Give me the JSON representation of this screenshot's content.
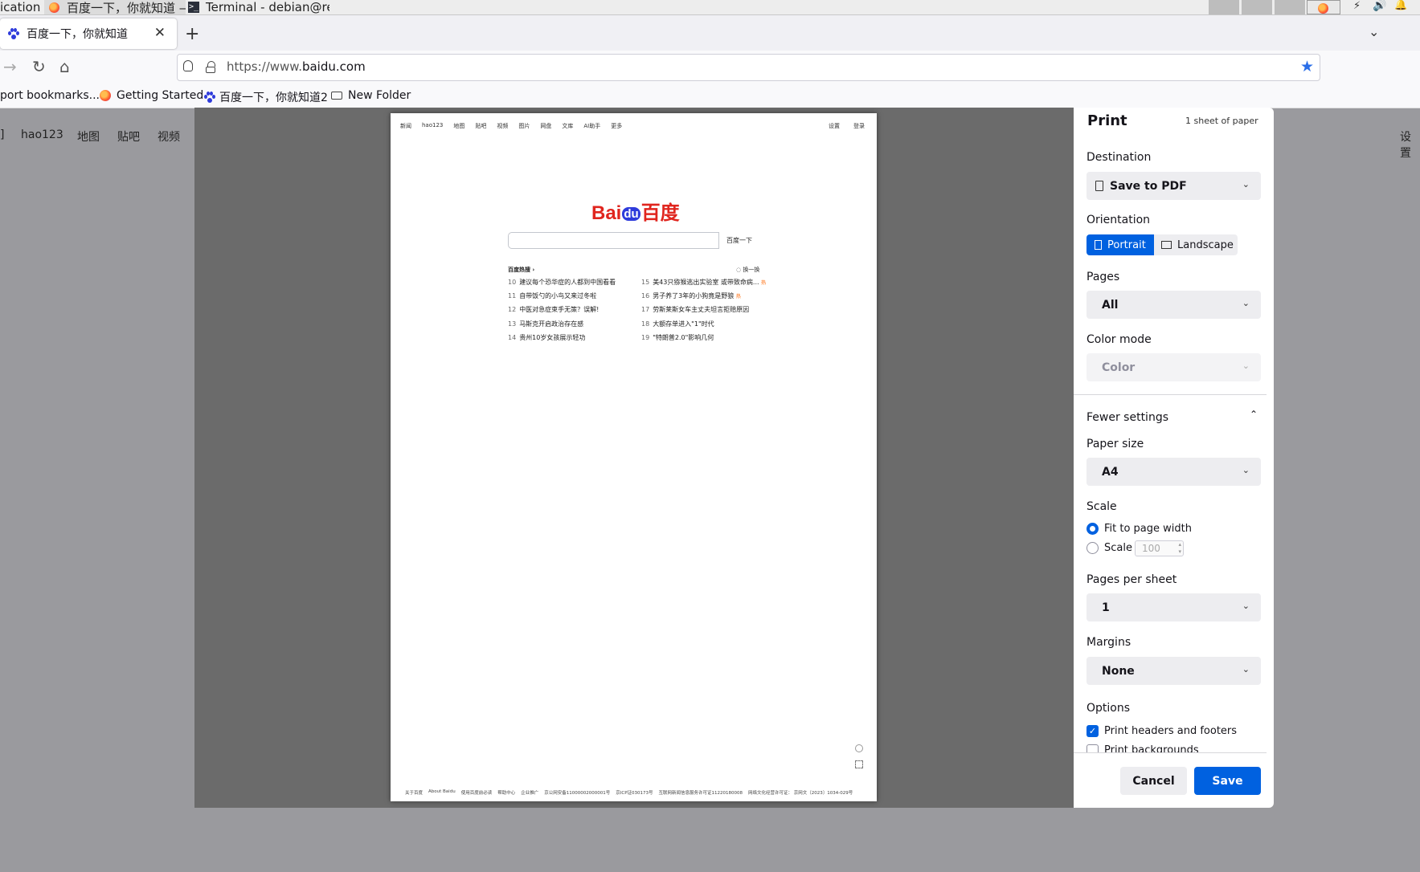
{
  "taskbar": {
    "apps_label": "ications",
    "firefox_window": "百度一下，你就知道 — Mo...",
    "terminal_window": "Terminal - debian@revyos..."
  },
  "browser": {
    "tab_title": "百度一下，你就知道",
    "new_tab": "+",
    "url_prefix": "https://www.",
    "url_domain": "baidu.com",
    "bookmarks": [
      "port bookmarks...",
      "Getting Started",
      "百度一下，你就知道2",
      "New Folder"
    ]
  },
  "page_behind": {
    "nav_left": [
      "]",
      "hao123",
      "地图",
      "贴吧",
      "视频"
    ],
    "nav_right": "设置"
  },
  "preview": {
    "topnav": [
      "新闻",
      "hao123",
      "地图",
      "贴吧",
      "视频",
      "图片",
      "网盘",
      "文库",
      "AI助手",
      "更多"
    ],
    "topnav_right": [
      "设置",
      "登录"
    ],
    "logo_left": "Bai",
    "logo_du": "du",
    "logo_right": "百度",
    "search_button": "百度一下",
    "hot_title": "百度热搜",
    "hot_refresh": "换一换",
    "hot_left": [
      {
        "n": "10",
        "t": "建议每个恐华症的人都到中国看看"
      },
      {
        "n": "11",
        "t": "自带饭勺的小鸟又来过冬啦"
      },
      {
        "n": "12",
        "t": "中医对急症束手无策？误解!"
      },
      {
        "n": "13",
        "t": "马斯克开启政治存在感"
      },
      {
        "n": "14",
        "t": "贵州10岁女孩展示轻功"
      }
    ],
    "hot_right": [
      {
        "n": "15",
        "t": "美43只猕猴逃出实验室 或带致命病..."
      },
      {
        "n": "16",
        "t": "男子养了3年的小狗竟是野狼"
      },
      {
        "n": "17",
        "t": "劳斯莱斯女车主丈夫坦言拒赔原因"
      },
      {
        "n": "18",
        "t": "大额存单进入\"1\"时代"
      },
      {
        "n": "19",
        "t": "\"特朗普2.0\"影响几何"
      }
    ],
    "hot_badge": "热",
    "footer": [
      "关于百度",
      "About Baidu",
      "使用百度前必读",
      "帮助中心",
      "企业推广",
      "京公网安备11000002000001号",
      "京ICP证030173号",
      "互联网新闻信息服务许可证11220180008",
      "网络文化经营许可证： 京网文〔2023〕1034-029号"
    ]
  },
  "print": {
    "title": "Print",
    "sheets": "1 sheet of paper",
    "destination_label": "Destination",
    "destination_value": "Save to PDF",
    "orientation_label": "Orientation",
    "portrait": "Portrait",
    "landscape": "Landscape",
    "orientation_selected": "Portrait",
    "pages_label": "Pages",
    "pages_value": "All",
    "color_label": "Color mode",
    "color_value": "Color",
    "fewer_settings": "Fewer settings",
    "paper_size_label": "Paper size",
    "paper_size_value": "A4",
    "scale_label": "Scale",
    "fit_label": "Fit to page width",
    "scale_option_label": "Scale",
    "scale_value": "100",
    "scale_selected": "fit",
    "pps_label": "Pages per sheet",
    "pps_value": "1",
    "margins_label": "Margins",
    "margins_value": "None",
    "options_label": "Options",
    "opt_headers": "Print headers and footers",
    "opt_headers_checked": true,
    "opt_backgrounds": "Print backgrounds",
    "opt_backgrounds_checked": false,
    "cancel": "Cancel",
    "save": "Save",
    "accent": "#0061e0"
  }
}
